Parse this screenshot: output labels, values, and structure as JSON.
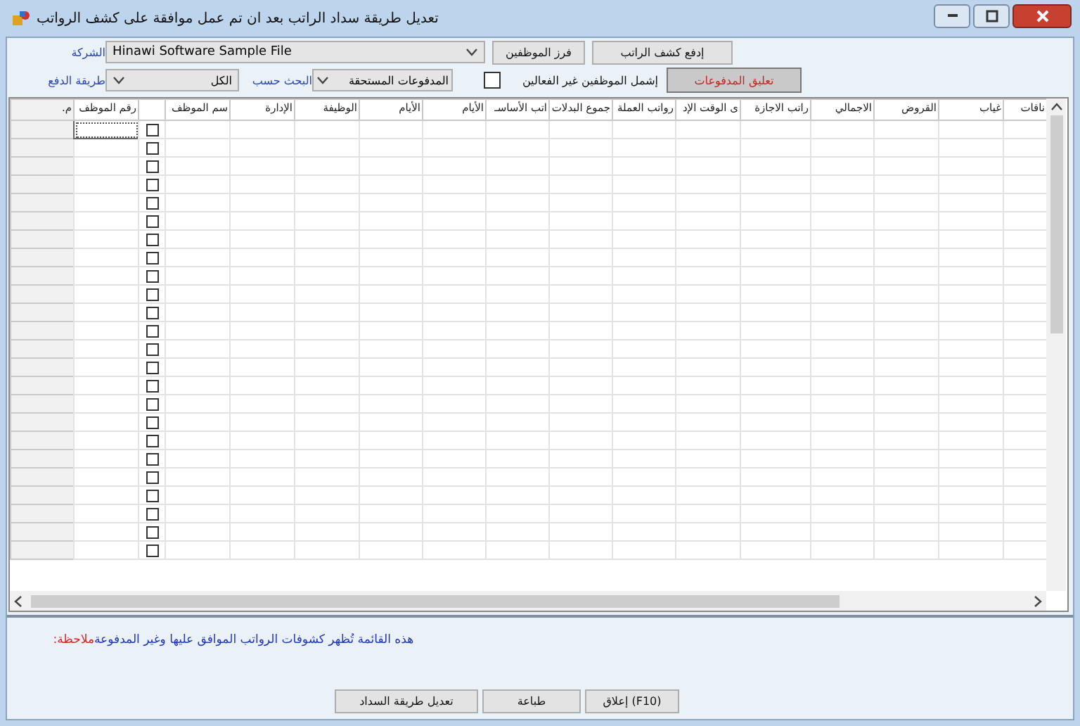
{
  "window": {
    "title": "تعديل طريقة سداد الراتب بعد ان تم عمل موافقة على كشف الرواتب"
  },
  "filters": {
    "company_label": "الشركة",
    "company_value": "Hinawi Software Sample File",
    "sort_button": "فرز الموظفين",
    "pay_button": "إدفع كشف الراتب",
    "payment_method_label": "طريقة الدفع",
    "payment_method_value": "الكل",
    "search_by_label": "البحث حسب",
    "search_by_value": "المدفوعات المستحقة",
    "include_inactive": {
      "label": "إشمل الموظفين غير الفعالين",
      "checked": false
    },
    "suspend_button": "تعليق المدفوعات"
  },
  "table": {
    "columns": [
      {
        "label": "ناقات",
        "kind": "text"
      },
      {
        "label": "غياب",
        "kind": "text"
      },
      {
        "label": "القروض",
        "kind": "text"
      },
      {
        "label": "الاجمالي",
        "kind": "text"
      },
      {
        "label": "راتب الاجازة",
        "kind": "text"
      },
      {
        "label": "ى الوقت الإد",
        "kind": "text"
      },
      {
        "label": "رواتب العملة",
        "kind": "text"
      },
      {
        "label": "جموع البدلات",
        "kind": "text"
      },
      {
        "label": "اتب الأساسـ",
        "kind": "text"
      },
      {
        "label": "الأيام",
        "kind": "text"
      },
      {
        "label": "الأيام",
        "kind": "text"
      },
      {
        "label": "الوظيفة",
        "kind": "text"
      },
      {
        "label": "الإدارة",
        "kind": "text"
      },
      {
        "label": "سم الموظف",
        "kind": "text"
      },
      {
        "kind": "check"
      },
      {
        "label": "رقم الموظف",
        "kind": "key"
      },
      {
        "label": "م.",
        "kind": "index"
      }
    ],
    "rows": [
      {
        "checked": false,
        "selected": true
      },
      {
        "checked": false,
        "selected": false
      },
      {
        "checked": false,
        "selected": false
      },
      {
        "checked": false,
        "selected": false
      },
      {
        "checked": false,
        "selected": false
      },
      {
        "checked": false,
        "selected": false
      },
      {
        "checked": false,
        "selected": false
      },
      {
        "checked": false,
        "selected": false
      },
      {
        "checked": false,
        "selected": false
      },
      {
        "checked": false,
        "selected": false
      },
      {
        "checked": false,
        "selected": false
      },
      {
        "checked": false,
        "selected": false
      },
      {
        "checked": false,
        "selected": false
      },
      {
        "checked": false,
        "selected": false
      },
      {
        "checked": false,
        "selected": false
      },
      {
        "checked": false,
        "selected": false
      },
      {
        "checked": false,
        "selected": false
      },
      {
        "checked": false,
        "selected": false
      },
      {
        "checked": false,
        "selected": false
      },
      {
        "checked": false,
        "selected": false
      },
      {
        "checked": false,
        "selected": false
      },
      {
        "checked": false,
        "selected": false
      },
      {
        "checked": false,
        "selected": false
      },
      {
        "checked": false,
        "selected": false
      }
    ]
  },
  "note": {
    "label": "ملاحظة:",
    "text": "هذه القائمة تُظهر كشوفات الرواتب الموافق عليها وغير المدفوعة"
  },
  "buttons": [
    "(F10) إعلاق",
    "طباعة",
    "تعديل طريقة السداد"
  ]
}
